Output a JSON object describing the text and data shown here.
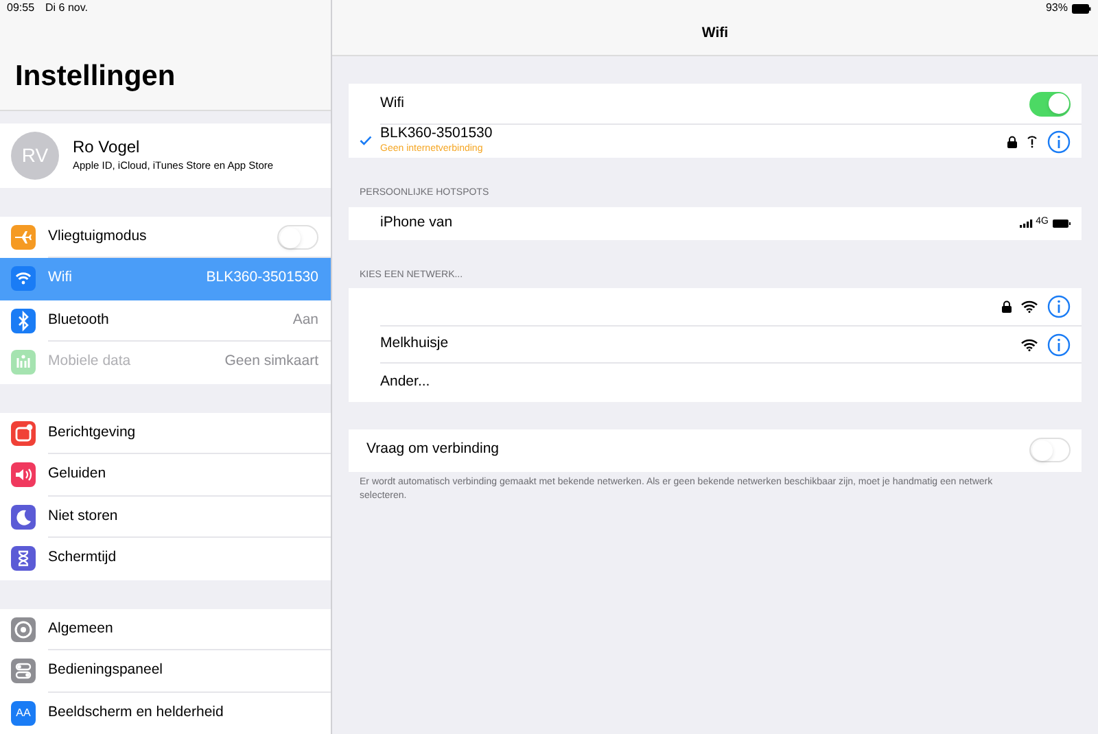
{
  "status_bar": {
    "time": "09:55",
    "date": "Di 6 nov.",
    "battery": "93%"
  },
  "sidebar": {
    "title": "Instellingen",
    "profile": {
      "initials": "RV",
      "name": "Ro Vogel",
      "subtitle": "Apple ID, iCloud, iTunes Store en App Store"
    },
    "groups": [
      {
        "items": [
          {
            "kind": "toggle",
            "label": "Vliegtuigmodus",
            "color": "#f59a23",
            "on": false,
            "selected": false,
            "disabled": false
          },
          {
            "kind": "value",
            "label": "Wifi",
            "value": "BLK360-3501530",
            "color": "#1a7cf5",
            "selected": true,
            "disabled": false
          },
          {
            "kind": "value",
            "label": "Bluetooth",
            "value": "Aan",
            "color": "#1a7cf5",
            "selected": false,
            "disabled": false
          },
          {
            "kind": "value",
            "label": "Mobiele data",
            "value": "Geen simkaart",
            "color": "#a5e3b0",
            "selected": false,
            "disabled": true
          }
        ]
      },
      {
        "items": [
          {
            "kind": "plain",
            "label": "Berichtgeving",
            "color": "#f04137",
            "selected": false,
            "disabled": false
          },
          {
            "kind": "plain",
            "label": "Geluiden",
            "color": "#f0395e",
            "selected": false,
            "disabled": false
          },
          {
            "kind": "plain",
            "label": "Niet storen",
            "color": "#5b5bd6",
            "selected": false,
            "disabled": false
          },
          {
            "kind": "plain",
            "label": "Schermtijd",
            "color": "#5b5bd6",
            "selected": false,
            "disabled": false
          }
        ]
      },
      {
        "items": [
          {
            "kind": "plain",
            "label": "Algemeen",
            "color": "#8e8e93",
            "selected": false,
            "disabled": false
          },
          {
            "kind": "plain",
            "label": "Bedieningspaneel",
            "color": "#8e8e93",
            "selected": false,
            "disabled": false
          },
          {
            "kind": "plain",
            "label": "Beeldscherm en helderheid",
            "icon_text": "AA",
            "color": "#1a7cf5",
            "selected": false,
            "disabled": false
          }
        ]
      }
    ]
  },
  "detail": {
    "title": "Wifi",
    "wifi_toggle": {
      "label": "Wifi",
      "on": true
    },
    "current_network": {
      "name": "BLK360-3501530",
      "status": "Geen internetverbinding",
      "checked": true,
      "locked": true
    },
    "hotspots": {
      "header": "PERSOONLIJKE HOTSPOTS",
      "items": [
        {
          "name": "iPhone van",
          "network": "4G"
        }
      ]
    },
    "networks": {
      "header": "KIES EEN NETWERK...",
      "items": [
        {
          "kind": "network",
          "locked": true
        },
        {
          "kind": "network",
          "name": "Melkhuisje",
          "locked": false
        },
        {
          "kind": "other",
          "name": "Ander..."
        }
      ]
    },
    "ask_to_join": {
      "label": "Vraag om verbinding",
      "on": false,
      "footer": "Er wordt automatisch verbinding gemaakt met bekende netwerken. Als er geen bekende netwerken beschikbaar zijn, moet je handmatig een netwerk selecteren."
    }
  }
}
